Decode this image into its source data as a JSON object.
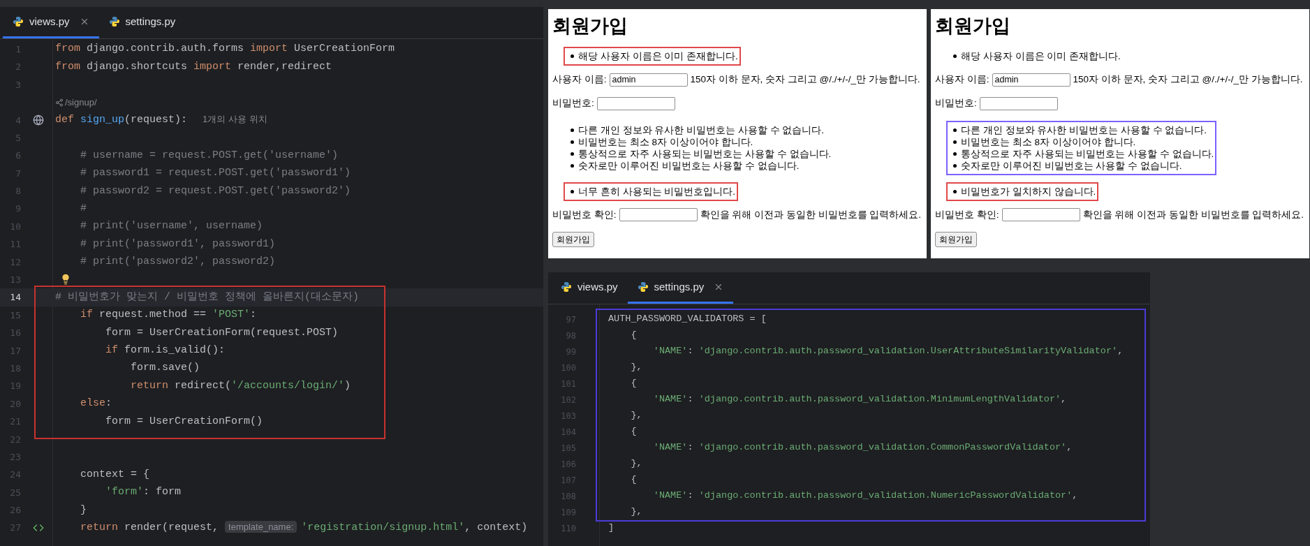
{
  "main_editor": {
    "tabs": [
      {
        "label": "views.py",
        "selected": true
      },
      {
        "label": "settings.py",
        "selected": false
      }
    ],
    "blocks": [
      {
        "boxed": false,
        "lines": [
          {
            "kind": "code",
            "number": "1",
            "current": false,
            "tokens": [
              {
                "text": "from",
                "kind": "keyword"
              },
              {
                "text": " django.contrib.auth.forms ",
                "kind": "plain"
              },
              {
                "text": "import",
                "kind": "keyword"
              },
              {
                "text": " UserCreationForm",
                "kind": "plain"
              }
            ]
          },
          {
            "kind": "code",
            "number": "2",
            "current": false,
            "tokens": [
              {
                "text": "from",
                "kind": "keyword"
              },
              {
                "text": " django.shortcuts ",
                "kind": "plain"
              },
              {
                "text": "import",
                "kind": "keyword"
              },
              {
                "text": " render,redirect",
                "kind": "plain"
              }
            ]
          },
          {
            "kind": "code",
            "number": "3",
            "current": false
          },
          {
            "kind": "route",
            "text": "/signup/"
          },
          {
            "kind": "view_def",
            "number": "4",
            "current": false,
            "tokens": [
              {
                "text": "def",
                "kind": "keyword"
              },
              {
                "text": " sign_up",
                "kind": "function"
              },
              {
                "text": "(request):",
                "kind": "plain"
              },
              {
                "text": "1개의 사용 위치",
                "kind": "hint"
              }
            ]
          },
          {
            "kind": "code",
            "number": "5",
            "current": false
          },
          {
            "kind": "code",
            "number": "6",
            "current": false,
            "tokens": [
              {
                "text": "    # username = request.POST.get('username')",
                "kind": "comment"
              }
            ]
          },
          {
            "kind": "code",
            "number": "7",
            "current": false,
            "tokens": [
              {
                "text": "    # password1 = request.POST.get('password1')",
                "kind": "comment"
              }
            ]
          },
          {
            "kind": "code",
            "number": "8",
            "current": false,
            "tokens": [
              {
                "text": "    # password2 = request.POST.get('password2')",
                "kind": "comment"
              }
            ]
          },
          {
            "kind": "code",
            "number": "9",
            "current": false,
            "tokens": [
              {
                "text": "    #",
                "kind": "comment"
              }
            ]
          },
          {
            "kind": "code",
            "number": "10",
            "current": false,
            "tokens": [
              {
                "text": "    # print('username', username)",
                "kind": "comment"
              }
            ]
          },
          {
            "kind": "code",
            "number": "11",
            "current": false,
            "tokens": [
              {
                "text": "    # print('password1', password1)",
                "kind": "comment"
              }
            ]
          },
          {
            "kind": "code",
            "number": "12",
            "current": false,
            "tokens": [
              {
                "text": "    # print('password2', password2)",
                "kind": "comment"
              }
            ]
          },
          {
            "kind": "intention",
            "number": "13",
            "current": false
          }
        ]
      },
      {
        "boxed": true,
        "color": "#c8322f",
        "lines": [
          {
            "kind": "code",
            "number": "14",
            "current": true,
            "tokens": [
              {
                "text": "# 비밀번호가 맞는지 / 비밀번호 정책에 올바른지(대소문자)",
                "kind": "comment"
              }
            ]
          },
          {
            "kind": "code",
            "number": "15",
            "current": false,
            "tokens": [
              {
                "text": "    if",
                "kind": "keyword"
              },
              {
                "text": " request.method == ",
                "kind": "plain"
              },
              {
                "text": "'POST'",
                "kind": "string"
              },
              {
                "text": ":",
                "kind": "plain"
              }
            ]
          },
          {
            "kind": "code",
            "number": "16",
            "current": false,
            "tokens": [
              {
                "text": "        form = UserCreationForm(request.POST)",
                "kind": "plain"
              }
            ]
          },
          {
            "kind": "code",
            "number": "17",
            "current": false,
            "tokens": [
              {
                "text": "        if",
                "kind": "keyword"
              },
              {
                "text": " form.is_valid():",
                "kind": "plain"
              }
            ]
          },
          {
            "kind": "code",
            "number": "18",
            "current": false,
            "tokens": [
              {
                "text": "            form.save()",
                "kind": "plain"
              }
            ]
          },
          {
            "kind": "code",
            "number": "19",
            "current": false,
            "tokens": [
              {
                "text": "            return",
                "kind": "keyword"
              },
              {
                "text": " redirect(",
                "kind": "plain"
              },
              {
                "text": "'/accounts/login/'",
                "kind": "string"
              },
              {
                "text": ")",
                "kind": "plain"
              }
            ]
          },
          {
            "kind": "code",
            "number": "20",
            "current": false,
            "tokens": [
              {
                "text": "    else",
                "kind": "keyword"
              },
              {
                "text": ":",
                "kind": "plain"
              }
            ]
          },
          {
            "kind": "code",
            "number": "21",
            "current": false,
            "tokens": [
              {
                "text": "        form = UserCreationForm()",
                "kind": "plain"
              }
            ]
          }
        ]
      },
      {
        "boxed": false,
        "lines": [
          {
            "kind": "code",
            "number": "22",
            "current": false
          },
          {
            "kind": "code",
            "number": "23",
            "current": false
          },
          {
            "kind": "code",
            "number": "24",
            "current": false,
            "tokens": [
              {
                "text": "    context = {",
                "kind": "plain"
              }
            ]
          },
          {
            "kind": "code",
            "number": "25",
            "current": false,
            "tokens": [
              {
                "text": "        'form'",
                "kind": "string"
              },
              {
                "text": ": form",
                "kind": "plain"
              }
            ]
          },
          {
            "kind": "code",
            "number": "26",
            "current": false,
            "tokens": [
              {
                "text": "    }",
                "kind": "plain"
              }
            ]
          },
          {
            "kind": "template_return",
            "number": "27",
            "current": false,
            "tokens": [
              {
                "text": "    return",
                "kind": "keyword"
              },
              {
                "text": " render(request, ",
                "kind": "plain"
              },
              {
                "text": "template_name:",
                "kind": "inlay"
              },
              {
                "text": "'registration/signup.html'",
                "kind": "string"
              },
              {
                "text": ", context)",
                "kind": "plain"
              }
            ]
          }
        ]
      }
    ]
  },
  "browsers": [
    {
      "blocks": [
        {
          "kind": "heading",
          "text": "회원가입"
        },
        {
          "kind": "list",
          "boxed": true,
          "color": "#e0484b",
          "items": [
            "해당 사용자 이름은 이미 존재합니다."
          ]
        },
        {
          "kind": "field",
          "label": "사용자 이름:",
          "value": "admin",
          "help": "150자 이하 문자, 숫자 그리고 @/./+/-/_만 가능합니다."
        },
        {
          "kind": "field",
          "label": "비밀번호:"
        },
        {
          "kind": "list",
          "boxed": false,
          "items": [
            "다른 개인 정보와 유사한 비밀번호는 사용할 수 없습니다.",
            "비밀번호는 최소 8자 이상이어야 합니다.",
            "통상적으로 자주 사용되는 비밀번호는 사용할 수 없습니다.",
            "숫자로만 이루어진 비밀번호는 사용할 수 없습니다."
          ]
        },
        {
          "kind": "list",
          "boxed": true,
          "color": "#e0484b",
          "items": [
            "너무 흔히 사용되는 비밀번호입니다."
          ]
        },
        {
          "kind": "field",
          "label": "비밀번호 확인:",
          "help": "확인을 위해 이전과 동일한 비밀번호를 입력하세요."
        },
        {
          "kind": "button",
          "text": "회원가입"
        }
      ]
    },
    {
      "blocks": [
        {
          "kind": "heading",
          "text": "회원가입"
        },
        {
          "kind": "list",
          "boxed": false,
          "items": [
            "해당 사용자 이름은 이미 존재합니다."
          ]
        },
        {
          "kind": "field",
          "label": "사용자 이름:",
          "value": "admin",
          "help": "150자 이하 문자, 숫자 그리고 @/./+/-/_만 가능합니다."
        },
        {
          "kind": "field",
          "label": "비밀번호:"
        },
        {
          "kind": "list",
          "boxed": true,
          "color": "#7b61ff",
          "items": [
            "다른 개인 정보와 유사한 비밀번호는 사용할 수 없습니다.",
            "비밀번호는 최소 8자 이상이어야 합니다.",
            "통상적으로 자주 사용되는 비밀번호는 사용할 수 없습니다.",
            "숫자로만 이루어진 비밀번호는 사용할 수 없습니다."
          ]
        },
        {
          "kind": "list",
          "boxed": true,
          "color": "#e0484b",
          "items": [
            "비밀번호가 일치하지 않습니다."
          ]
        },
        {
          "kind": "field",
          "label": "비밀번호 확인:",
          "help": "확인을 위해 이전과 동일한 비밀번호를 입력하세요."
        },
        {
          "kind": "button",
          "text": "회원가입"
        }
      ]
    }
  ],
  "settings_editor": {
    "tabs": [
      {
        "label": "views.py",
        "selected": false
      },
      {
        "label": "settings.py",
        "selected": true
      }
    ],
    "blocks": [
      {
        "boxed": true,
        "color": "#4b3bd6",
        "lines": [
          {
            "number": "97",
            "tokens": [
              {
                "text": "AUTH_PASSWORD_VALIDATORS = [",
                "kind": "plain"
              }
            ]
          },
          {
            "number": "98",
            "tokens": [
              {
                "text": "    {",
                "kind": "plain"
              }
            ]
          },
          {
            "number": "99",
            "tokens": [
              {
                "text": "        'NAME'",
                "kind": "string"
              },
              {
                "text": ": ",
                "kind": "plain"
              },
              {
                "text": "'django.contrib.auth.password_validation.UserAttributeSimilarityValidator'",
                "kind": "string"
              },
              {
                "text": ",",
                "kind": "plain"
              }
            ]
          },
          {
            "number": "100",
            "tokens": [
              {
                "text": "    },",
                "kind": "plain"
              }
            ]
          },
          {
            "number": "101",
            "tokens": [
              {
                "text": "    {",
                "kind": "plain"
              }
            ]
          },
          {
            "number": "102",
            "tokens": [
              {
                "text": "        'NAME'",
                "kind": "string"
              },
              {
                "text": ": ",
                "kind": "plain"
              },
              {
                "text": "'django.contrib.auth.password_validation.MinimumLengthValidator'",
                "kind": "string"
              },
              {
                "text": ",",
                "kind": "plain"
              }
            ]
          },
          {
            "number": "103",
            "tokens": [
              {
                "text": "    },",
                "kind": "plain"
              }
            ]
          },
          {
            "number": "104",
            "tokens": [
              {
                "text": "    {",
                "kind": "plain"
              }
            ]
          },
          {
            "number": "105",
            "tokens": [
              {
                "text": "        'NAME'",
                "kind": "string"
              },
              {
                "text": ": ",
                "kind": "plain"
              },
              {
                "text": "'django.contrib.auth.password_validation.CommonPasswordValidator'",
                "kind": "string"
              },
              {
                "text": ",",
                "kind": "plain"
              }
            ]
          },
          {
            "number": "106",
            "tokens": [
              {
                "text": "    },",
                "kind": "plain"
              }
            ]
          },
          {
            "number": "107",
            "tokens": [
              {
                "text": "    {",
                "kind": "plain"
              }
            ]
          },
          {
            "number": "108",
            "tokens": [
              {
                "text": "        'NAME'",
                "kind": "string"
              },
              {
                "text": ": ",
                "kind": "plain"
              },
              {
                "text": "'django.contrib.auth.password_validation.NumericPasswordValidator'",
                "kind": "string"
              },
              {
                "text": ",",
                "kind": "plain"
              }
            ]
          },
          {
            "number": "109",
            "tokens": [
              {
                "text": "    },",
                "kind": "plain"
              }
            ]
          }
        ]
      },
      {
        "boxed": false,
        "lines": [
          {
            "number": "110",
            "tokens": [
              {
                "text": "]",
                "kind": "plain"
              }
            ]
          }
        ]
      }
    ]
  }
}
